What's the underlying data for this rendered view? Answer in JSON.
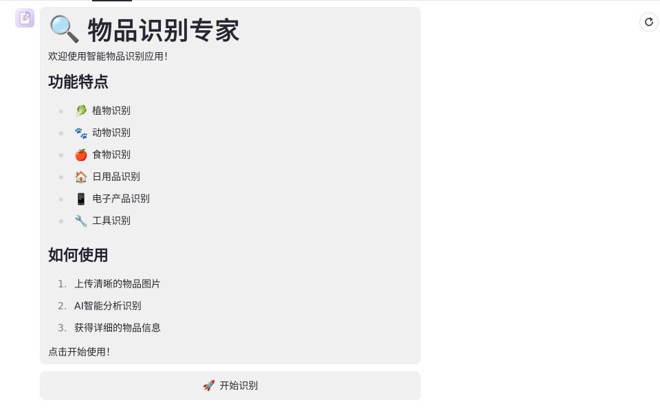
{
  "header": {
    "title_icon": "magnifier-icon",
    "title": "物品识别专家",
    "welcome": "欢迎使用智能物品识别应用！"
  },
  "features": {
    "heading": "功能特点",
    "items": [
      {
        "icon": "leaf-icon",
        "glyph": "🥬",
        "label": "植物识别"
      },
      {
        "icon": "paw-icon",
        "glyph": "🐾",
        "label": "动物识别"
      },
      {
        "icon": "apple-icon",
        "glyph": "🍎",
        "label": "食物识别"
      },
      {
        "icon": "house-icon",
        "glyph": "🏠",
        "label": "日用品识别"
      },
      {
        "icon": "phone-icon",
        "glyph": "📱",
        "label": "电子产品识别"
      },
      {
        "icon": "tool-icon",
        "glyph": "🔧",
        "label": "工具识别"
      }
    ]
  },
  "howto": {
    "heading": "如何使用",
    "steps": [
      {
        "num": "1.",
        "label": "上传清晰的物品图片"
      },
      {
        "num": "2.",
        "label": "AI智能分析识别"
      },
      {
        "num": "3.",
        "label": "获得详细的物品信息"
      }
    ]
  },
  "cta_text": "点击开始使用！",
  "start_button": {
    "icon": "rocket-icon",
    "glyph": "🚀",
    "label": "开始识别"
  },
  "colors": {
    "card_bg": "#f0f0f0",
    "text": "#262730"
  }
}
